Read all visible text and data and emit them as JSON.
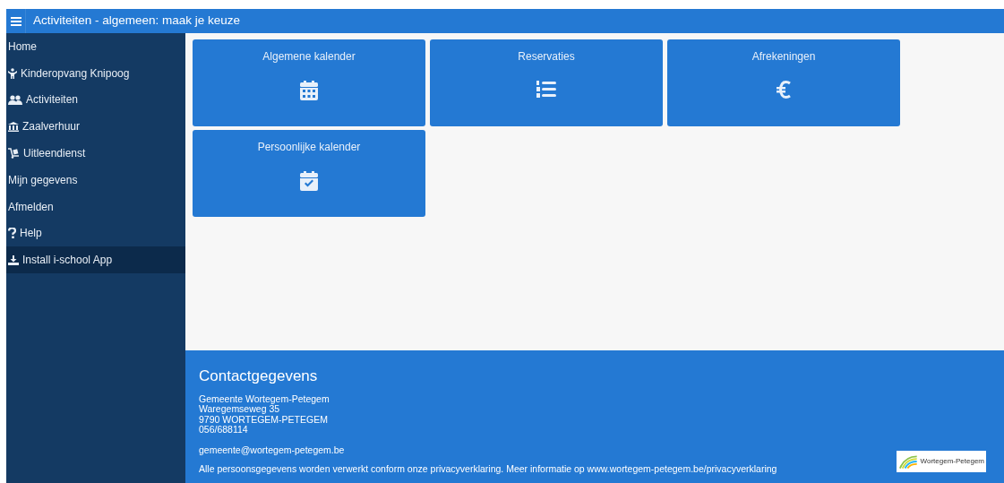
{
  "header": {
    "title": "Activiteiten - algemeen: maak je keuze"
  },
  "sidebar": {
    "items": [
      {
        "label": "Home",
        "selected": false
      },
      {
        "label": "Kinderopvang Knipoog",
        "selected": false
      },
      {
        "label": "Activiteiten",
        "selected": false
      },
      {
        "label": "Zaalverhuur",
        "selected": false
      },
      {
        "label": "Uitleendienst",
        "selected": false
      },
      {
        "label": "Mijn gegevens",
        "selected": false
      },
      {
        "label": "Afmelden",
        "selected": false
      },
      {
        "label": "Help",
        "selected": false
      },
      {
        "label": "Install i-school App",
        "selected": true
      }
    ]
  },
  "tiles": [
    {
      "label": "Algemene kalender"
    },
    {
      "label": "Reservaties"
    },
    {
      "label": "Afrekeningen"
    },
    {
      "label": "Persoonlijke kalender"
    }
  ],
  "footer": {
    "title": "Contactgegevens",
    "address": [
      "Gemeente Wortegem-Petegem",
      "Waregemseweg 35",
      "9790 WORTEGEM-PETEGEM",
      "056/688114"
    ],
    "email": "gemeente@wortegem-petegem.be",
    "privacy": "Alle persoonsgegevens worden verwerkt conform onze privacyverklaring. Meer informatie op www.wortegem-petegem.be/privacyverklaring",
    "logo_text": "Wortegem-Petegem"
  }
}
